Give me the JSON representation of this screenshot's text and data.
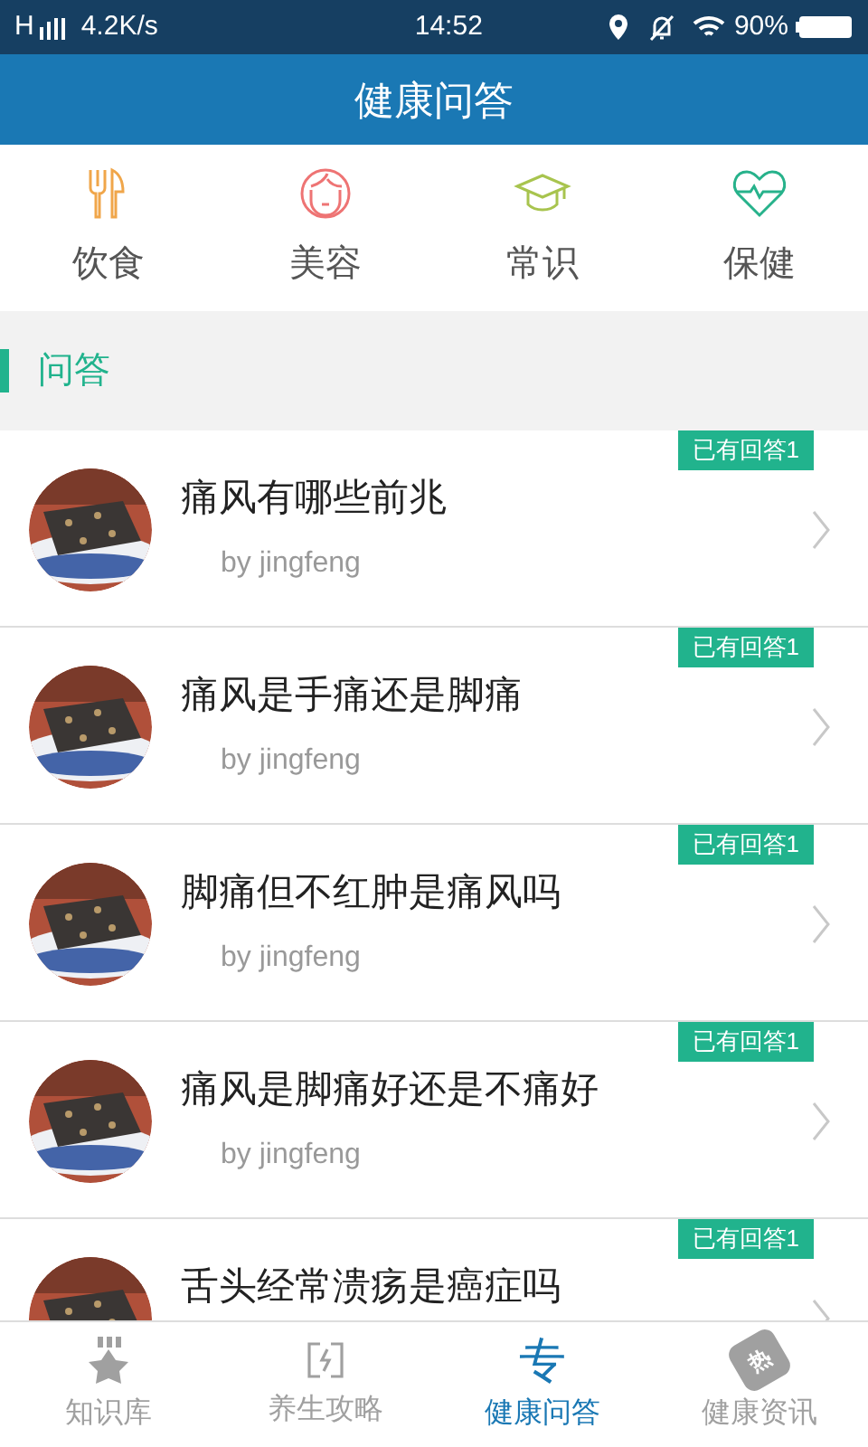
{
  "status_bar": {
    "network": "H",
    "speed": "4.2K/s",
    "time": "14:52",
    "battery": "90%"
  },
  "header": {
    "title": "健康问答"
  },
  "categories": [
    {
      "label": "饮食",
      "kind": "food"
    },
    {
      "label": "美容",
      "kind": "beauty"
    },
    {
      "label": "常识",
      "kind": "knowledge"
    },
    {
      "label": "保健",
      "kind": "health"
    }
  ],
  "section": {
    "title": "问答"
  },
  "questions": [
    {
      "title": "痛风有哪些前兆",
      "author": "by jingfeng",
      "badge": "已有回答1"
    },
    {
      "title": "痛风是手痛还是脚痛",
      "author": "by jingfeng",
      "badge": "已有回答1"
    },
    {
      "title": "脚痛但不红肿是痛风吗",
      "author": "by jingfeng",
      "badge": "已有回答1"
    },
    {
      "title": "痛风是脚痛好还是不痛好",
      "author": "by jingfeng",
      "badge": "已有回答1"
    },
    {
      "title": "舌头经常溃疡是癌症吗",
      "badge": "已有回答1"
    }
  ],
  "bottom_nav": [
    {
      "label": "知识库",
      "kind": "star",
      "selected": false
    },
    {
      "label": "养生攻略",
      "kind": "frame",
      "selected": false
    },
    {
      "label": "健康问答",
      "kind": "glyph",
      "glyph": "专",
      "selected": true
    },
    {
      "label": "健康资讯",
      "kind": "tag",
      "glyph": "热",
      "selected": false
    }
  ]
}
